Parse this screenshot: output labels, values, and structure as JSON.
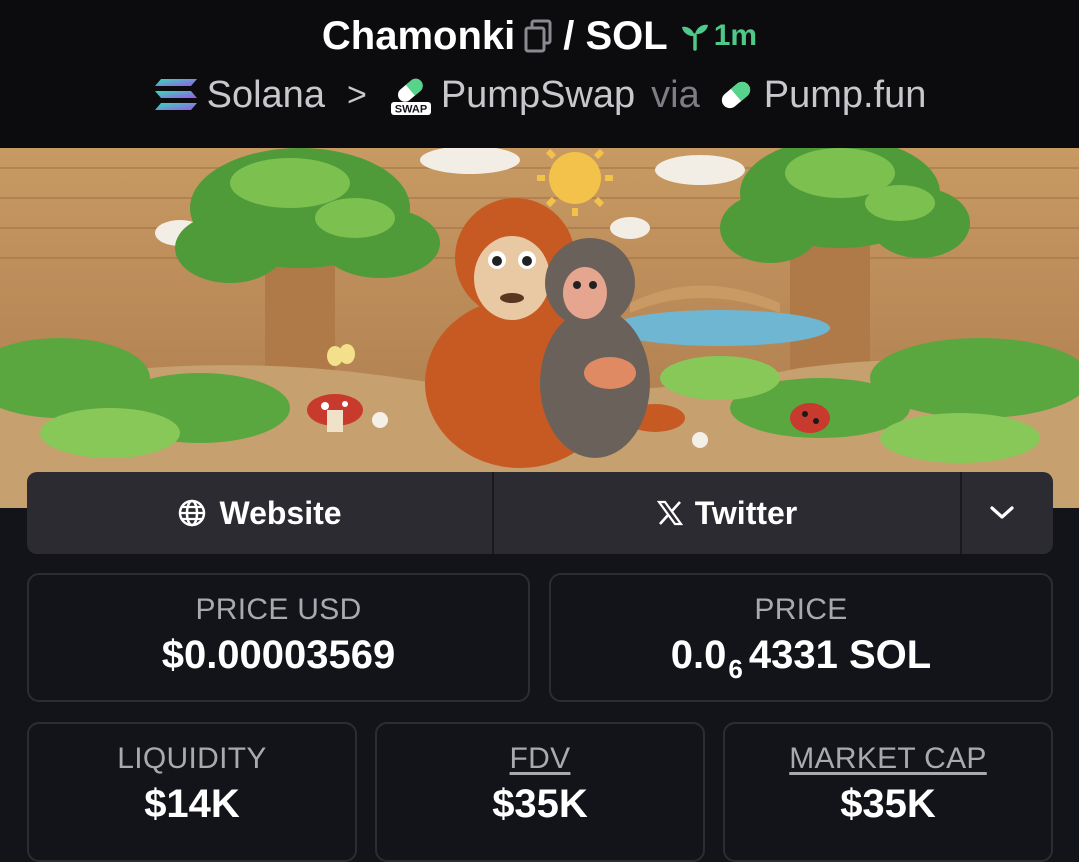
{
  "header": {
    "token_name": "Chamonki",
    "pair_suffix": "/ SOL",
    "age": "1m",
    "chain": "Solana",
    "separator": ">",
    "dex": "PumpSwap",
    "dex_badge": "SWAP",
    "via": "via",
    "launchpad": "Pump.fun"
  },
  "links": {
    "website": "Website",
    "twitter": "Twitter"
  },
  "stats": {
    "price_usd_label": "PRICE USD",
    "price_usd_value": "$0.00003569",
    "price_label": "PRICE",
    "price_prefix": "0.0",
    "price_zeros": "6",
    "price_digits": "4331 SOL",
    "liquidity_label": "LIQUIDITY",
    "liquidity_value": "$14K",
    "fdv_label": "FDV",
    "fdv_value": "$35K",
    "mcap_label": "MARKET CAP",
    "mcap_value": "$35K"
  },
  "colors": {
    "background": "#131419",
    "header_bg": "#0c0c0e",
    "age_green": "#4ec98a",
    "card_border": "#2c2c32",
    "button_bg": "#2b2b31"
  },
  "icons": [
    "copy-icon",
    "sprout-icon",
    "solana-icon",
    "chevron-right-icon",
    "pumpswap-icon",
    "pill-icon",
    "globe-icon",
    "x-logo-icon",
    "chevron-down-icon"
  ]
}
